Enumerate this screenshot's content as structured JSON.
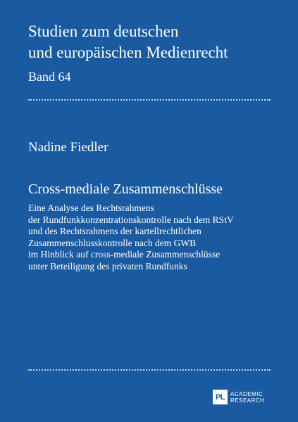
{
  "series": {
    "line1": "Studien zum deutschen",
    "line2": "und europäischen Medienrecht",
    "band": "Band 64"
  },
  "author": "Nadine Fiedler",
  "title": "Cross-mediale Zusammenschlüsse",
  "subtitle_lines": [
    "Eine Analyse des Rechtsrahmens",
    "der Rundfunkkonzentrationskontrolle nach dem RStV",
    "und des Rechtsrahmens der kartellrechtlichen",
    "Zusammenschlusskontrolle nach dem GWB",
    "im Hinblick auf cross-mediale Zusammenschlüsse",
    "unter Beteiligung des privaten Rundfunks"
  ],
  "publisher": {
    "mark": "PL",
    "line1": "ACADEMIC",
    "line2": "RESEARCH"
  },
  "colors": {
    "background": "#1a5aa0",
    "text": "#ffffff"
  }
}
